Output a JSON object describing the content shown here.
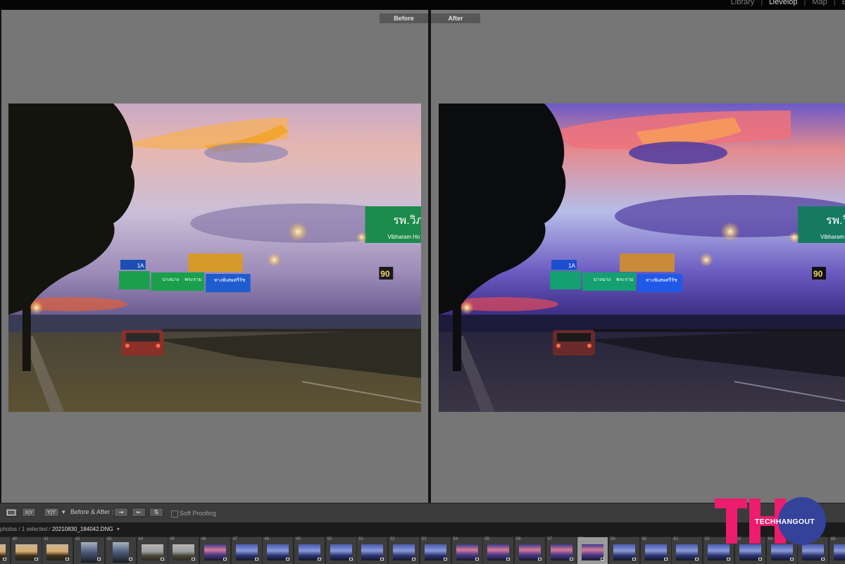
{
  "modules": {
    "items": [
      {
        "label": "Library",
        "active": false
      },
      {
        "label": "Develop",
        "active": true
      },
      {
        "label": "Map",
        "active": false
      },
      {
        "label": "B",
        "active": false
      }
    ]
  },
  "view": {
    "before_label": "Before",
    "after_label": "After"
  },
  "photo": {
    "sign_main_text": "รพ.วิภา",
    "sign_sub_text": "Vibharam",
    "sign_sub_text2": "Ho",
    "speed_sign": "90",
    "sign_1a": "1A",
    "sign_green_text": "บางนาง",
    "sign_green_en": "Bang Kapi",
    "sign_green_text2": "พระราม",
    "sign_blue_text": "ทางพิเศษศรีรัช",
    "sign_blue_en": "Si Rat Expressway"
  },
  "toolbar": {
    "loupe_icon": "single-view-icon",
    "before_after_label": "Before & After :",
    "yy_label": "Y|Y",
    "soft_proofing_label": "Soft Proofing",
    "soft_proofing_checked": false
  },
  "filmstrip": {
    "source_text": "photos / 1 selected /",
    "filename": "20210830_184042.DNG",
    "dropdown_icon": "dropdown-arrow-icon",
    "selected_index": 58,
    "cells": [
      {
        "num": "",
        "kind": "dusk"
      },
      {
        "num": "40",
        "kind": "dusk"
      },
      {
        "num": "41",
        "kind": "dusk"
      },
      {
        "num": "42",
        "kind": "tall"
      },
      {
        "num": "43",
        "kind": "tall"
      },
      {
        "num": "44",
        "kind": "day"
      },
      {
        "num": "45",
        "kind": "day"
      },
      {
        "num": "46",
        "kind": "pink"
      },
      {
        "num": "47",
        "kind": "blue"
      },
      {
        "num": "48",
        "kind": "blue"
      },
      {
        "num": "49",
        "kind": "blue"
      },
      {
        "num": "50",
        "kind": "blue"
      },
      {
        "num": "51",
        "kind": "blue"
      },
      {
        "num": "52",
        "kind": "blue"
      },
      {
        "num": "53",
        "kind": "blue"
      },
      {
        "num": "54",
        "kind": "pink"
      },
      {
        "num": "55",
        "kind": "pink"
      },
      {
        "num": "56",
        "kind": "pink"
      },
      {
        "num": "57",
        "kind": "pink"
      },
      {
        "num": "58",
        "kind": "pink"
      },
      {
        "num": "59",
        "kind": "blue"
      },
      {
        "num": "60",
        "kind": "blue"
      },
      {
        "num": "61",
        "kind": "blue"
      },
      {
        "num": "62",
        "kind": "blue"
      },
      {
        "num": "63",
        "kind": "blue"
      },
      {
        "num": "64",
        "kind": "blue"
      },
      {
        "num": "65",
        "kind": "blue"
      },
      {
        "num": "66",
        "kind": "blue"
      }
    ]
  },
  "watermark": {
    "text": "TECHHANGOUT",
    "letters": "TH",
    "pink": "#ec1c6e",
    "blue": "#34429a"
  },
  "colors": {
    "pane_gray": "#767676",
    "toolbar": "#3b3b3b",
    "filmstrip": "#262626"
  }
}
